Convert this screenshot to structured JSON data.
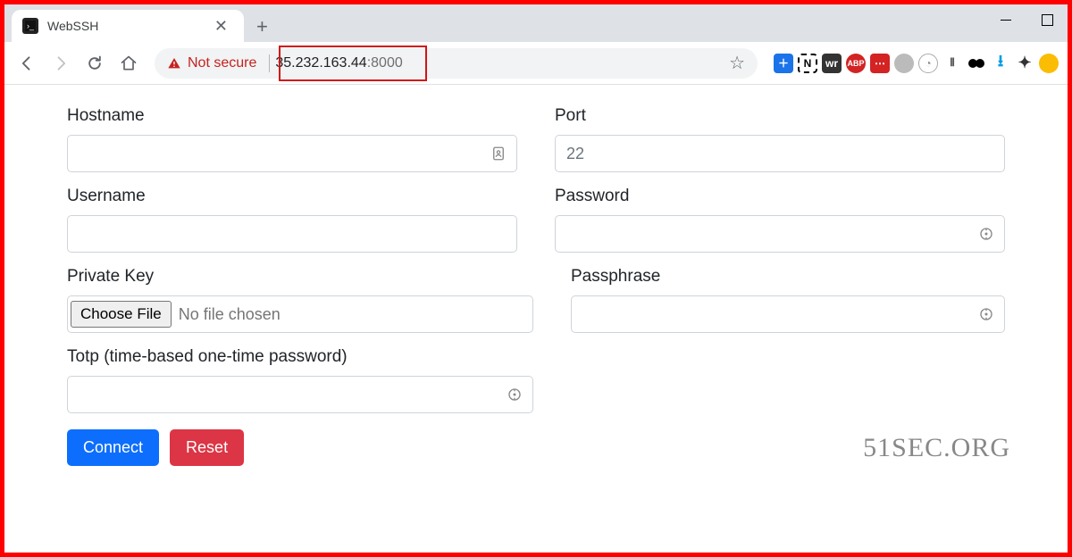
{
  "browser": {
    "tab_title": "WebSSH",
    "not_secure": "Not secure",
    "url_host": "35.232.163.44",
    "url_port": ":8000"
  },
  "form": {
    "hostname_label": "Hostname",
    "port_label": "Port",
    "port_placeholder": "22",
    "username_label": "Username",
    "password_label": "Password",
    "privatekey_label": "Private Key",
    "passphrase_label": "Passphrase",
    "choose_file_btn": "Choose File",
    "file_status": "No file chosen",
    "totp_label": "Totp (time-based one-time password)",
    "connect_btn": "Connect",
    "reset_btn": "Reset"
  },
  "watermark": "51SEC.ORG"
}
